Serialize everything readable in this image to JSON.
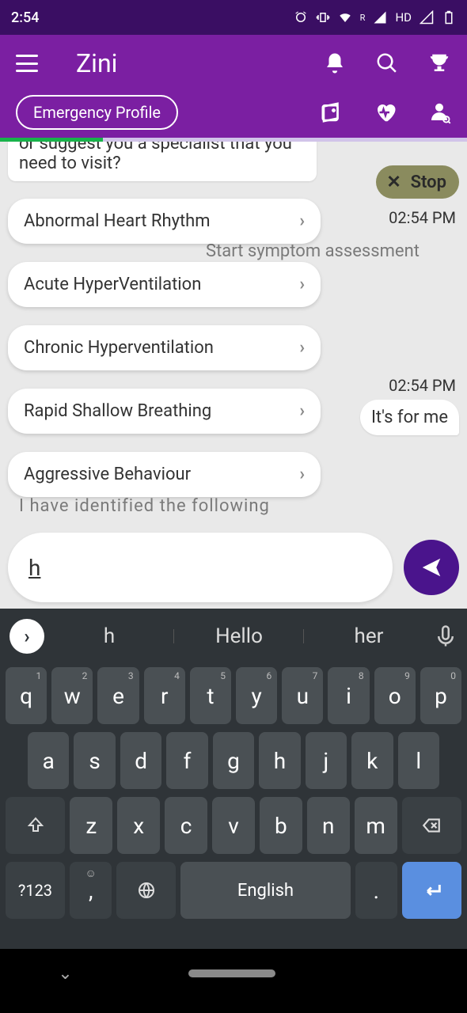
{
  "status": {
    "time": "2:54",
    "hd": "HD",
    "r": "R"
  },
  "app": {
    "title": "Zini",
    "emergency_label": "Emergency Profile"
  },
  "chat": {
    "partial_top": "or suggest you a specialist that you need to visit?",
    "stop_label": "Stop",
    "ts1": "02:54 PM",
    "behind1": "Start symptom assessment",
    "ts2": "02:54 PM",
    "reply1": "It's for me",
    "behind2": "I have identified the following",
    "options": [
      "Abnormal Heart Rhythm",
      "Acute HyperVentilation",
      "Chronic Hyperventilation",
      "Rapid Shallow Breathing",
      "Aggressive Behaviour"
    ],
    "input_value": "h"
  },
  "keyboard": {
    "suggestions": [
      "h",
      "Hello",
      "her"
    ],
    "row1": [
      {
        "k": "q",
        "n": "1"
      },
      {
        "k": "w",
        "n": "2"
      },
      {
        "k": "e",
        "n": "3"
      },
      {
        "k": "r",
        "n": "4"
      },
      {
        "k": "t",
        "n": "5"
      },
      {
        "k": "y",
        "n": "6"
      },
      {
        "k": "u",
        "n": "7"
      },
      {
        "k": "i",
        "n": "8"
      },
      {
        "k": "o",
        "n": "9"
      },
      {
        "k": "p",
        "n": "0"
      }
    ],
    "row2": [
      "a",
      "s",
      "d",
      "f",
      "g",
      "h",
      "j",
      "k",
      "l"
    ],
    "row3": [
      "z",
      "x",
      "c",
      "v",
      "b",
      "n",
      "m"
    ],
    "sym": "?123",
    "comma": ",",
    "space": "English",
    "dot": "."
  }
}
